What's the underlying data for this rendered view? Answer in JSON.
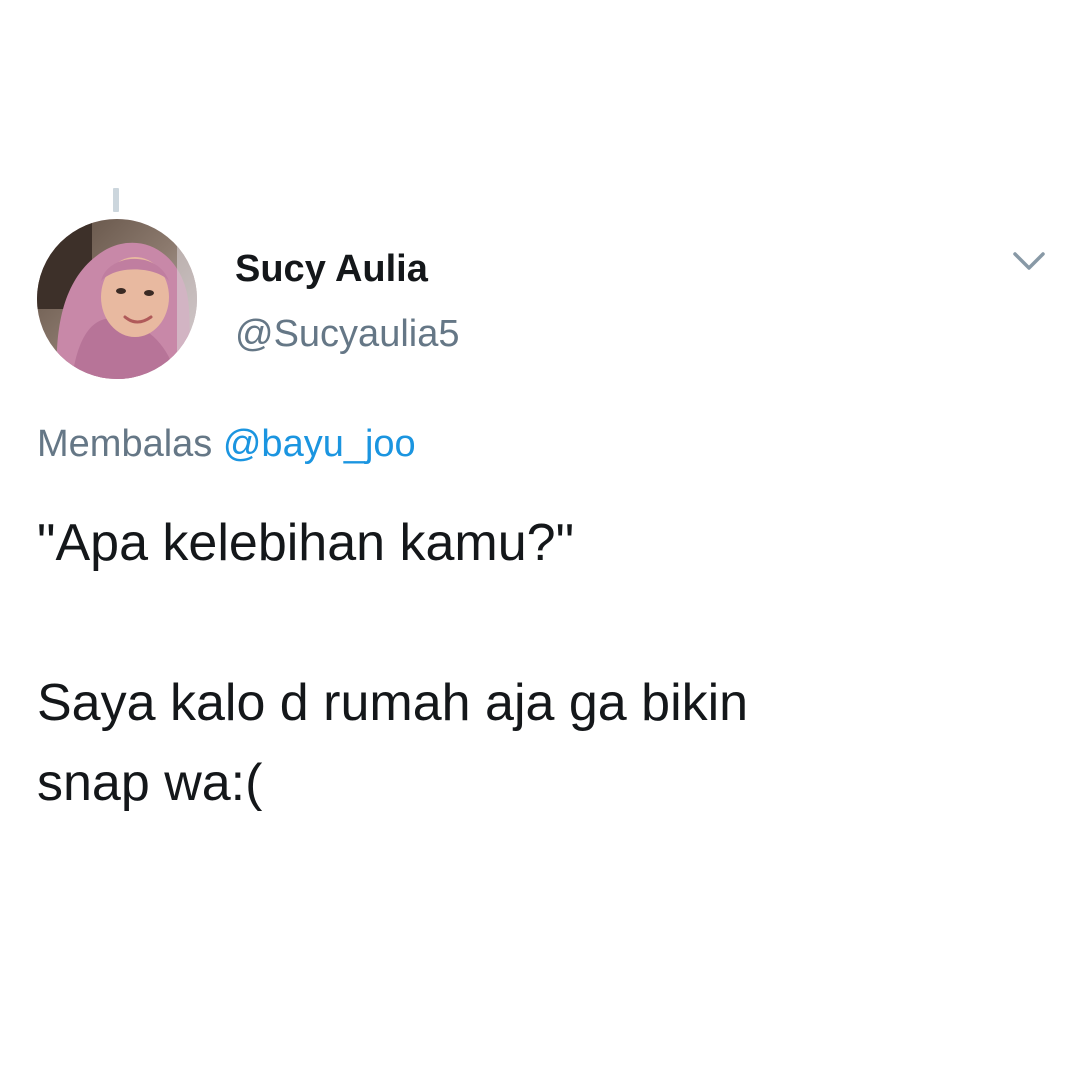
{
  "tweet": {
    "author": {
      "display_name": "Sucy Aulia",
      "handle": "@Sucyaulia5",
      "avatar": "profile-photo"
    },
    "reply_context": {
      "prefix": "Membalas",
      "mention": "@bayu_joo"
    },
    "text": {
      "paragraph_1": "\"Apa kelebihan kamu?\"",
      "paragraph_2_line_1": "Saya kalo d rumah aja ga bikin",
      "paragraph_2_line_2": "snap wa:("
    },
    "menu_icon": "chevron-down-icon"
  },
  "colors": {
    "text_primary": "#14171a",
    "text_secondary": "#657786",
    "mention": "#1b95e0",
    "thread_line": "#ccd6dd",
    "background": "#ffffff"
  }
}
